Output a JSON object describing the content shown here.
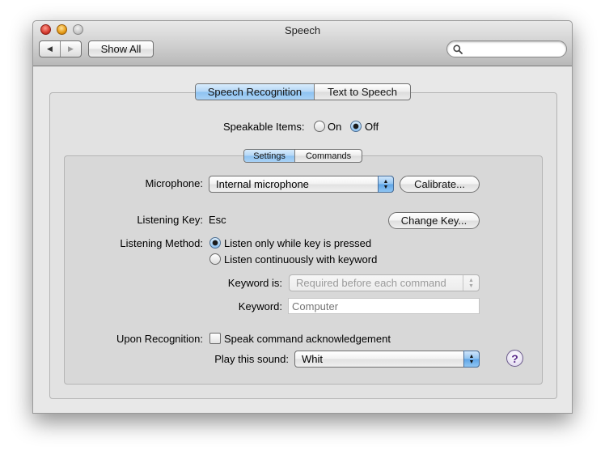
{
  "window": {
    "title": "Speech"
  },
  "toolbar": {
    "show_all_label": "Show All",
    "search_placeholder": ""
  },
  "main_tabs": [
    {
      "label": "Speech Recognition",
      "selected": true
    },
    {
      "label": "Text to Speech",
      "selected": false
    }
  ],
  "speakable": {
    "label": "Speakable Items:",
    "options": [
      {
        "label": "On",
        "selected": false
      },
      {
        "label": "Off",
        "selected": true
      }
    ]
  },
  "sub_tabs": [
    {
      "label": "Settings",
      "selected": true
    },
    {
      "label": "Commands",
      "selected": false
    }
  ],
  "microphone": {
    "label": "Microphone:",
    "value": "Internal microphone",
    "calibrate_label": "Calibrate..."
  },
  "listening_key": {
    "label": "Listening Key:",
    "value": "Esc",
    "change_label": "Change Key..."
  },
  "listening_method": {
    "label": "Listening Method:",
    "options": [
      {
        "label": "Listen only while key is pressed",
        "selected": true
      },
      {
        "label": "Listen continuously with keyword",
        "selected": false
      }
    ]
  },
  "keyword_is": {
    "label": "Keyword is:",
    "value": "Required before each command"
  },
  "keyword": {
    "label": "Keyword:",
    "placeholder": "Computer"
  },
  "upon_recognition": {
    "label": "Upon Recognition:",
    "checkbox_label": "Speak command acknowledgement",
    "checked": false
  },
  "play_sound": {
    "label": "Play this sound:",
    "value": "Whit"
  },
  "help": {
    "glyph": "?"
  }
}
